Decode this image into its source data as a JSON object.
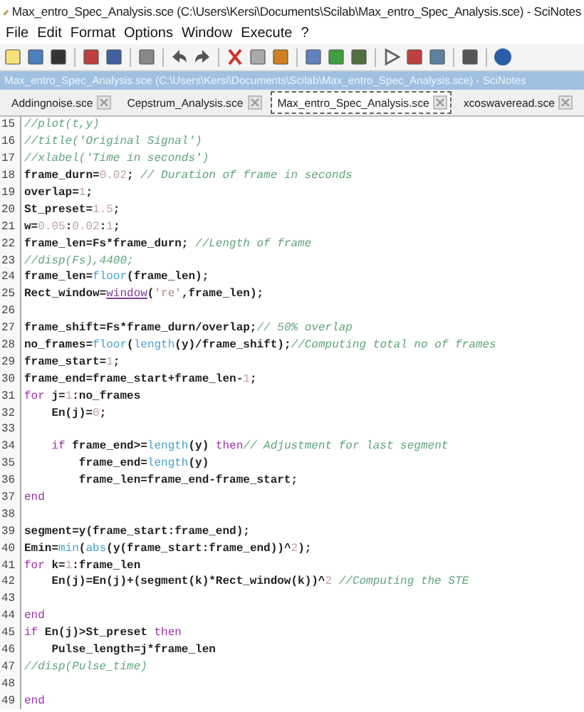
{
  "window": {
    "title": "Max_entro_Spec_Analysis.sce (C:\\Users\\Kersi\\Documents\\Scilab\\Max_entro_Spec_Analysis.sce) - SciNotes"
  },
  "menu": [
    "File",
    "Edit",
    "Format",
    "Options",
    "Window",
    "Execute",
    "?"
  ],
  "panel_title": "Max_entro_Spec_Analysis.sce (C:\\Users\\Kersi\\Documents\\Scilab\\Max_entro_Spec_Analysis.sce) - SciNotes",
  "tabs": [
    {
      "label": "Addingnoise.sce",
      "selected": false
    },
    {
      "label": "Cepstrum_Analysis.sce",
      "selected": false
    },
    {
      "label": "Max_entro_Spec_Analysis.sce",
      "selected": true
    },
    {
      "label": "xcoswaveread.sce",
      "selected": false
    }
  ],
  "lines": [
    {
      "number": "15",
      "tokens": [
        {
          "kind": "comment",
          "text": "//plot(t,y)"
        }
      ]
    },
    {
      "number": "16",
      "tokens": [
        {
          "kind": "comment",
          "text": "//title('Original Signal')"
        }
      ]
    },
    {
      "number": "17",
      "tokens": [
        {
          "kind": "comment",
          "text": "//xlabel('Time in seconds')"
        }
      ]
    },
    {
      "number": "18",
      "tokens": [
        {
          "kind": "plain",
          "text": "frame_durn="
        },
        {
          "kind": "number",
          "text": "0.02"
        },
        {
          "kind": "plain",
          "text": "; "
        },
        {
          "kind": "comment",
          "text": "// Duration of frame in seconds"
        }
      ]
    },
    {
      "number": "19",
      "tokens": [
        {
          "kind": "plain",
          "text": "overlap="
        },
        {
          "kind": "number",
          "text": "1"
        },
        {
          "kind": "plain",
          "text": ";"
        }
      ]
    },
    {
      "number": "20",
      "tokens": [
        {
          "kind": "plain",
          "text": "St_preset="
        },
        {
          "kind": "number",
          "text": "1.5"
        },
        {
          "kind": "plain",
          "text": ";"
        }
      ]
    },
    {
      "number": "21",
      "tokens": [
        {
          "kind": "plain",
          "text": "w="
        },
        {
          "kind": "number",
          "text": "0.05"
        },
        {
          "kind": "plain",
          "text": ":"
        },
        {
          "kind": "number",
          "text": "0.02"
        },
        {
          "kind": "plain",
          "text": ":"
        },
        {
          "kind": "number",
          "text": "1"
        },
        {
          "kind": "plain",
          "text": ";"
        }
      ]
    },
    {
      "number": "22",
      "tokens": [
        {
          "kind": "plain",
          "text": "frame_len=Fs*frame_durn; "
        },
        {
          "kind": "comment",
          "text": "//Length of frame"
        }
      ]
    },
    {
      "number": "23",
      "tokens": [
        {
          "kind": "comment",
          "text": "//disp(Fs),4400;"
        }
      ]
    },
    {
      "number": "24",
      "tokens": [
        {
          "kind": "plain",
          "text": "frame_len="
        },
        {
          "kind": "func",
          "text": "floor"
        },
        {
          "kind": "plain",
          "text": "(frame_len);"
        }
      ]
    },
    {
      "number": "25",
      "tokens": [
        {
          "kind": "plain",
          "text": "Rect_window="
        },
        {
          "kind": "link",
          "text": "window"
        },
        {
          "kind": "plain",
          "text": "("
        },
        {
          "kind": "string",
          "text": "'re'"
        },
        {
          "kind": "plain",
          "text": ",frame_len);"
        }
      ]
    },
    {
      "number": "26"
    },
    {
      "number": "27",
      "tokens": [
        {
          "kind": "plain",
          "text": "frame_shift=Fs*frame_durn/overlap;"
        },
        {
          "kind": "comment",
          "text": "// 50% overlap"
        }
      ]
    },
    {
      "number": "28",
      "tokens": [
        {
          "kind": "plain",
          "text": "no_frames="
        },
        {
          "kind": "func",
          "text": "floor"
        },
        {
          "kind": "plain",
          "text": "("
        },
        {
          "kind": "func",
          "text": "length"
        },
        {
          "kind": "plain",
          "text": "(y)/frame_shift);"
        },
        {
          "kind": "comment",
          "text": "//Computing total no of frames"
        }
      ]
    },
    {
      "number": "29",
      "tokens": [
        {
          "kind": "plain",
          "text": "frame_start="
        },
        {
          "kind": "number",
          "text": "1"
        },
        {
          "kind": "plain",
          "text": ";"
        }
      ]
    },
    {
      "number": "30",
      "tokens": [
        {
          "kind": "plain",
          "text": "frame_end=frame_start+frame_len-"
        },
        {
          "kind": "number",
          "text": "1"
        },
        {
          "kind": "plain",
          "text": ";"
        }
      ]
    },
    {
      "number": "31",
      "tokens": [
        {
          "kind": "keyword",
          "text": "for"
        },
        {
          "kind": "plain",
          "text": " j="
        },
        {
          "kind": "number",
          "text": "1"
        },
        {
          "kind": "plain",
          "text": ":no_frames"
        }
      ]
    },
    {
      "number": "32",
      "tokens": [
        {
          "kind": "plain",
          "text": "    En(j)="
        },
        {
          "kind": "number",
          "text": "0"
        },
        {
          "kind": "plain",
          "text": ";"
        }
      ]
    },
    {
      "number": "33"
    },
    {
      "number": "34",
      "tokens": [
        {
          "kind": "keyword",
          "text": "    if"
        },
        {
          "kind": "plain",
          "text": " frame_end>="
        },
        {
          "kind": "func",
          "text": "length"
        },
        {
          "kind": "plain",
          "text": "(y) "
        },
        {
          "kind": "keyword",
          "text": "then"
        },
        {
          "kind": "comment",
          "text": "// Adjustment for last segment"
        }
      ]
    },
    {
      "number": "35",
      "tokens": [
        {
          "kind": "plain",
          "text": "        frame_end="
        },
        {
          "kind": "func",
          "text": "length"
        },
        {
          "kind": "plain",
          "text": "(y)"
        }
      ]
    },
    {
      "number": "36",
      "tokens": [
        {
          "kind": "plain",
          "text": "        frame_len=frame_end-frame_start;"
        }
      ]
    },
    {
      "number": "37",
      "tokens": [
        {
          "kind": "keyword",
          "text": "end"
        }
      ]
    },
    {
      "number": "38"
    },
    {
      "number": "39",
      "tokens": [
        {
          "kind": "plain",
          "text": "segment=y(frame_start:frame_end);"
        }
      ]
    },
    {
      "number": "40",
      "tokens": [
        {
          "kind": "plain",
          "text": "Emin="
        },
        {
          "kind": "func",
          "text": "min"
        },
        {
          "kind": "plain",
          "text": "("
        },
        {
          "kind": "func",
          "text": "abs"
        },
        {
          "kind": "plain",
          "text": "(y(frame_start:frame_end))^"
        },
        {
          "kind": "number",
          "text": "2"
        },
        {
          "kind": "plain",
          "text": ");"
        }
      ]
    },
    {
      "number": "41",
      "tokens": [
        {
          "kind": "keyword",
          "text": "for"
        },
        {
          "kind": "plain",
          "text": " k="
        },
        {
          "kind": "number",
          "text": "1"
        },
        {
          "kind": "plain",
          "text": ":frame_len"
        }
      ]
    },
    {
      "number": "42",
      "tokens": [
        {
          "kind": "plain",
          "text": "    En(j)=En(j)+(segment(k)*Rect_window(k))^"
        },
        {
          "kind": "number",
          "text": "2"
        },
        {
          "kind": "comment",
          "text": " //Computing the STE"
        }
      ]
    },
    {
      "number": "43"
    },
    {
      "number": "44",
      "tokens": [
        {
          "kind": "keyword",
          "text": "end"
        }
      ]
    },
    {
      "number": "45",
      "tokens": [
        {
          "kind": "keyword",
          "text": "if"
        },
        {
          "kind": "plain",
          "text": " En(j)>St_preset "
        },
        {
          "kind": "keyword",
          "text": "then"
        }
      ]
    },
    {
      "number": "46",
      "tokens": [
        {
          "kind": "plain",
          "text": "    Pulse_length=j*frame_len"
        }
      ]
    },
    {
      "number": "47",
      "tokens": [
        {
          "kind": "comment",
          "text": "//disp(Pulse_time)"
        }
      ]
    },
    {
      "number": "48"
    },
    {
      "number": "49",
      "tokens": [
        {
          "kind": "keyword",
          "text": "end"
        }
      ]
    }
  ]
}
